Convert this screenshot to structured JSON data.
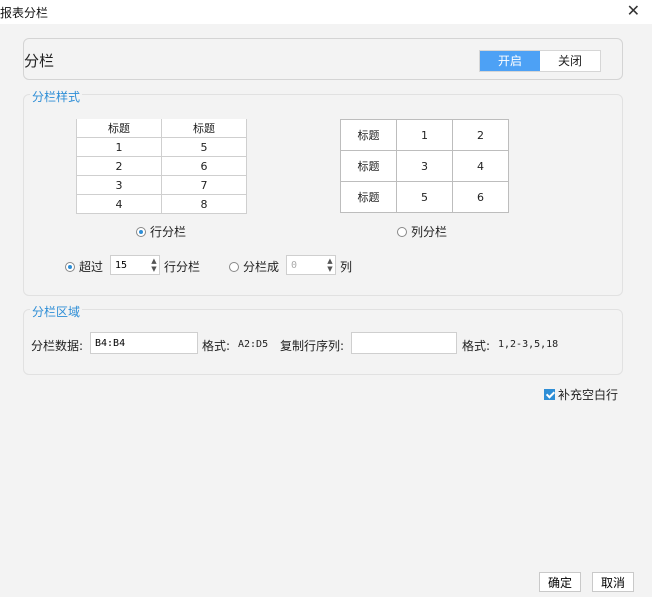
{
  "window": {
    "title": "报表分栏"
  },
  "toggle": {
    "label": "分栏",
    "on_label": "开启",
    "off_label": "关闭"
  },
  "style_group": {
    "title": "分栏样式",
    "row_table": {
      "headers": [
        "标题",
        "标题"
      ],
      "rows": [
        [
          "1",
          "5"
        ],
        [
          "2",
          "6"
        ],
        [
          "3",
          "7"
        ],
        [
          "4",
          "8"
        ]
      ]
    },
    "col_table": {
      "rows": [
        [
          "标题",
          "1",
          "2"
        ],
        [
          "标题",
          "3",
          "4"
        ],
        [
          "标题",
          "5",
          "6"
        ]
      ]
    },
    "row_option": "行分栏",
    "col_option": "列分栏",
    "exceed_label": "超过",
    "exceed_value": "15",
    "exceed_suffix": "行分栏",
    "split_label": "分栏成",
    "split_value": "0",
    "split_suffix": "列"
  },
  "region_group": {
    "title": "分栏区域",
    "data_label": "分栏数据:",
    "data_value": "B4:B4",
    "format_label1": "格式:",
    "format_example1": "A2:D5",
    "copy_label": "复制行序列:",
    "copy_value": "",
    "format_label2": "格式:",
    "format_example2": "1,2-3,5,18"
  },
  "fill_blank": {
    "label": "补充空白行",
    "checked": true
  },
  "buttons": {
    "ok": "确定",
    "cancel": "取消"
  }
}
